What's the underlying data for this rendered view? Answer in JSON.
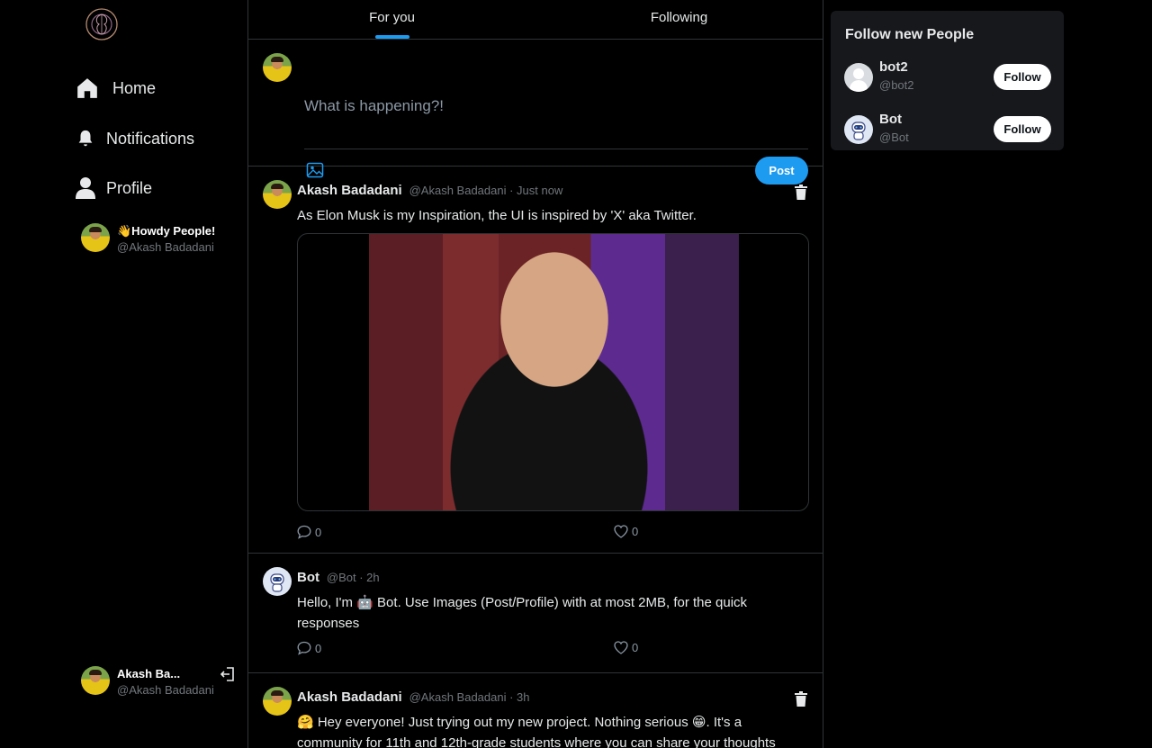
{
  "sidebar": {
    "logo_icon": "brain-mandala-icon",
    "nav": [
      {
        "label": "Home",
        "icon": "home-icon"
      },
      {
        "label": "Notifications",
        "icon": "bell-icon"
      },
      {
        "label": "Profile",
        "icon": "user-icon"
      }
    ],
    "greeting": {
      "name": "👋Howdy People!",
      "handle": "@Akash Badadani"
    },
    "account": {
      "name": "Akash Ba...",
      "handle": "@Akash Badadani",
      "logout_icon": "logout-icon"
    }
  },
  "feed": {
    "tabs": [
      {
        "label": "For you",
        "active": true
      },
      {
        "label": "Following",
        "active": false
      }
    ],
    "composer": {
      "placeholder": "What is happening?!",
      "post_label": "Post",
      "image_icon": "image-icon"
    },
    "posts": [
      {
        "author": "Akash Badadani",
        "meta": "@Akash Badadani · Just now",
        "text": "As Elon Musk is my Inspiration, the UI is inspired by 'X' aka Twitter.",
        "has_image": true,
        "comments": "0",
        "likes": "0"
      },
      {
        "author": "Bot",
        "meta": "@Bot · 2h",
        "text": "Hello, I'm 🤖 Bot. Use Images (Post/Profile) with at most 2MB, for the quick responses",
        "comments": "0",
        "likes": "0"
      },
      {
        "author": "Akash Badadani",
        "meta": "@Akash Badadani · 3h",
        "text": "🤗 Hey everyone! Just trying out my new project. Nothing serious 😁. It's a community for 11th and 12th-grade students where you can share your thoughts"
      }
    ]
  },
  "follow": {
    "title": "Follow new People",
    "suggestions": [
      {
        "name": "bot2",
        "handle": "@bot2",
        "button": "Follow"
      },
      {
        "name": "Bot",
        "handle": "@Bot",
        "button": "Follow"
      }
    ]
  },
  "colors": {
    "accent": "#1d9bf0",
    "background": "#000000",
    "card": "#16181c",
    "border": "#2f3336"
  }
}
